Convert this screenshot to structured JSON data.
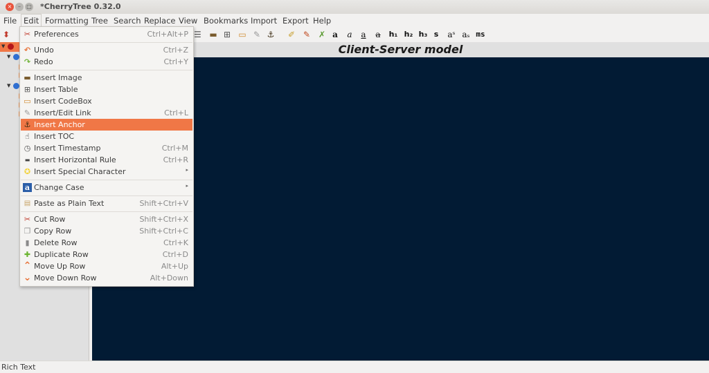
{
  "window": {
    "title": "*CherryTree 0.32.0",
    "close_glyph": "×",
    "min_glyph": "–",
    "max_glyph": "□"
  },
  "menubar": {
    "items": [
      {
        "label": "File"
      },
      {
        "label": "Edit"
      },
      {
        "label": "Formatting"
      },
      {
        "label": "Tree"
      },
      {
        "label": "Search"
      },
      {
        "label": "Replace"
      },
      {
        "label": "View"
      },
      {
        "label": "Bookmarks"
      },
      {
        "label": "Import"
      },
      {
        "label": "Export"
      },
      {
        "label": "Help"
      }
    ],
    "active": "Edit"
  },
  "toolbar": {
    "buttons": [
      {
        "name": "insert-image",
        "glyph": "▬"
      },
      {
        "name": "insert-table",
        "glyph": "⊞"
      },
      {
        "name": "insert-codebox",
        "glyph": "▭"
      },
      {
        "name": "insert-link",
        "glyph": "✎"
      },
      {
        "name": "insert-anchor",
        "glyph": "⚓"
      },
      {
        "name": "format-color-fg",
        "glyph": "✐"
      },
      {
        "name": "format-color-bg",
        "glyph": "✎"
      },
      {
        "name": "remove-format",
        "glyph": "✗"
      },
      {
        "name": "bold",
        "glyph": "a"
      },
      {
        "name": "italic",
        "glyph": "a"
      },
      {
        "name": "underline",
        "glyph": "a"
      },
      {
        "name": "strikethrough",
        "glyph": "a"
      },
      {
        "name": "h1",
        "glyph": "h₁"
      },
      {
        "name": "h2",
        "glyph": "h₂"
      },
      {
        "name": "h3",
        "glyph": "h₃"
      },
      {
        "name": "small",
        "glyph": "s"
      },
      {
        "name": "superscript",
        "glyph": "aˢ"
      },
      {
        "name": "subscript",
        "glyph": "aₛ"
      },
      {
        "name": "monospace",
        "glyph": "ms"
      }
    ]
  },
  "node": {
    "title": "Client-Server model"
  },
  "status": {
    "text": "Rich Text"
  },
  "edit_menu": {
    "items": [
      {
        "label": "Preferences",
        "accel": "Ctrl+Alt+P",
        "icon": "preferences-icon",
        "glyph": "✂",
        "color": "#c0392b"
      },
      {
        "label": "Undo",
        "accel": "Ctrl+Z",
        "icon": "undo-icon",
        "glyph": "↶",
        "color": "#e8743b"
      },
      {
        "label": "Redo",
        "accel": "Ctrl+Y",
        "icon": "redo-icon",
        "glyph": "↷",
        "color": "#73b43c"
      },
      {
        "label": "Insert Image",
        "accel": "",
        "icon": "image-icon",
        "glyph": "▬",
        "color": "#7a5c2e"
      },
      {
        "label": "Insert Table",
        "accel": "",
        "icon": "table-icon",
        "glyph": "⊞",
        "color": "#555555"
      },
      {
        "label": "Insert CodeBox",
        "accel": "",
        "icon": "codebox-icon",
        "glyph": "▭",
        "color": "#d08a2e"
      },
      {
        "label": "Insert/Edit Link",
        "accel": "Ctrl+L",
        "icon": "link-icon",
        "glyph": "✎",
        "color": "#9a9a9a"
      },
      {
        "label": "Insert Anchor",
        "accel": "",
        "icon": "anchor-icon",
        "glyph": "⚓",
        "color": "#3a2a10"
      },
      {
        "label": "Insert TOC",
        "accel": "",
        "icon": "toc-icon",
        "glyph": "☝",
        "color": "#333333"
      },
      {
        "label": "Insert Timestamp",
        "accel": "Ctrl+M",
        "icon": "timestamp-icon",
        "glyph": "◷",
        "color": "#555555"
      },
      {
        "label": "Insert Horizontal Rule",
        "accel": "Ctrl+R",
        "icon": "horizontal-rule-icon",
        "glyph": "▬",
        "color": "#444444"
      },
      {
        "label": "Insert Special Character",
        "accel": "",
        "icon": "special-character-icon",
        "glyph": "✪",
        "color": "#f2d23a",
        "submenu": true
      },
      {
        "label": "Change Case",
        "accel": "",
        "icon": "change-case-icon",
        "glyph": "a",
        "color": "#2b5ea8",
        "submenu": true
      },
      {
        "label": "Paste as Plain Text",
        "accel": "Shift+Ctrl+V",
        "icon": "paste-icon",
        "glyph": "📋",
        "color": "#c9a66b"
      },
      {
        "label": "Cut Row",
        "accel": "Shift+Ctrl+X",
        "icon": "cut-icon",
        "glyph": "✂",
        "color": "#c0392b"
      },
      {
        "label": "Copy Row",
        "accel": "Shift+Ctrl+C",
        "icon": "copy-icon",
        "glyph": "❐",
        "color": "#9a9a9a"
      },
      {
        "label": "Delete Row",
        "accel": "Ctrl+K",
        "icon": "delete-icon",
        "glyph": "▮",
        "color": "#8a8a8a"
      },
      {
        "label": "Duplicate Row",
        "accel": "Ctrl+D",
        "icon": "duplicate-icon",
        "glyph": "✚",
        "color": "#6ab42f"
      },
      {
        "label": "Move Up Row",
        "accel": "Alt+Up",
        "icon": "move-up-icon",
        "glyph": "⌃",
        "color": "#e8743b"
      },
      {
        "label": "Move Down Row",
        "accel": "Alt+Down",
        "icon": "move-down-icon",
        "glyph": "⌄",
        "color": "#e8743b"
      }
    ],
    "highlighted": "Insert Anchor"
  },
  "colors": {
    "accent": "#f07746",
    "editor_bg": "#021b34"
  }
}
